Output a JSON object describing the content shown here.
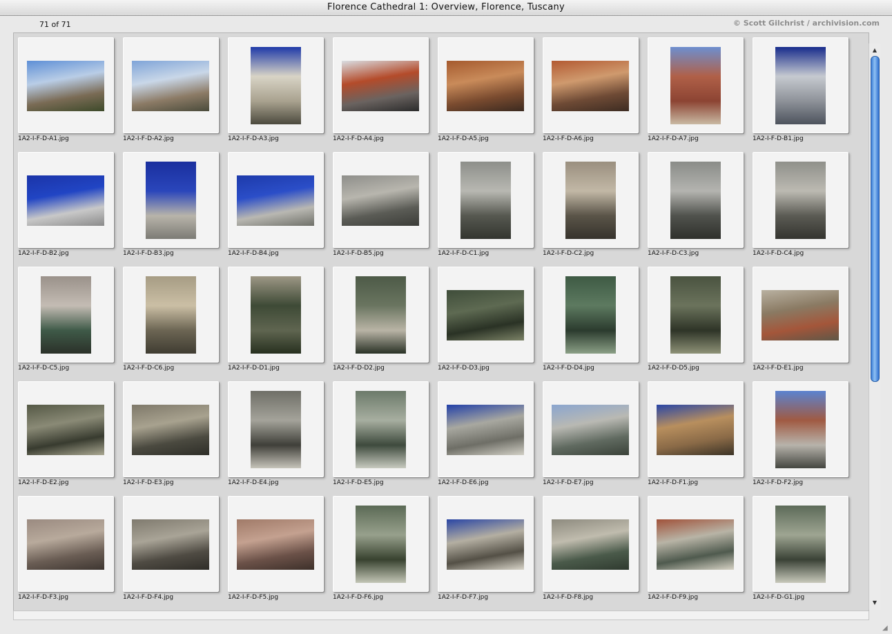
{
  "window": {
    "title": "Florence Cathedral 1: Overview, Florence, Tuscany"
  },
  "header": {
    "count": "71 of 71",
    "credit": "© Scott Gilchrist / archivision.com"
  },
  "thumbnails": [
    {
      "name": "1A2-I-F-D-A1.jpg",
      "orient": "land",
      "colors": [
        "#5e8fd6",
        "#b9cde6",
        "#7a6b55",
        "#3d4a2a"
      ]
    },
    {
      "name": "1A2-I-F-D-A2.jpg",
      "orient": "land",
      "colors": [
        "#7fa4d8",
        "#c9d7e8",
        "#8c7b66",
        "#4a4b3b"
      ]
    },
    {
      "name": "1A2-I-F-D-A3.jpg",
      "orient": "port",
      "colors": [
        "#1f3aa8",
        "#d8d4c6",
        "#a9a28f",
        "#4c4a3e"
      ]
    },
    {
      "name": "1A2-I-F-D-A4.jpg",
      "orient": "land",
      "colors": [
        "#d9dde2",
        "#b44b2a",
        "#6a6360",
        "#2b2b2b"
      ]
    },
    {
      "name": "1A2-I-F-D-A5.jpg",
      "orient": "land",
      "colors": [
        "#a55a2e",
        "#c98b5a",
        "#7a4b2f",
        "#3b2a20"
      ]
    },
    {
      "name": "1A2-I-F-D-A6.jpg",
      "orient": "land",
      "colors": [
        "#b35a32",
        "#cf9a6e",
        "#6e4a35",
        "#3d2c22"
      ]
    },
    {
      "name": "1A2-I-F-D-A7.jpg",
      "orient": "port",
      "colors": [
        "#6d8fcf",
        "#b06048",
        "#8c4433",
        "#c9b9a3"
      ]
    },
    {
      "name": "1A2-I-F-D-B1.jpg",
      "orient": "port",
      "colors": [
        "#182c8c",
        "#c6cad0",
        "#8e9299",
        "#4d535d"
      ]
    },
    {
      "name": "1A2-I-F-D-B2.jpg",
      "orient": "land",
      "colors": [
        "#1b34a8",
        "#2145c4",
        "#c8c8c8",
        "#8a8a8a"
      ]
    },
    {
      "name": "1A2-I-F-D-B3.jpg",
      "orient": "port",
      "colors": [
        "#1a2f9e",
        "#2a46bb",
        "#b8b4aa",
        "#7c7b75"
      ]
    },
    {
      "name": "1A2-I-F-D-B4.jpg",
      "orient": "land",
      "colors": [
        "#1d3aaa",
        "#2b4ec8",
        "#b9b8b2",
        "#6f7069"
      ]
    },
    {
      "name": "1A2-I-F-D-B5.jpg",
      "orient": "land",
      "colors": [
        "#8e8e8a",
        "#b8b6ae",
        "#5b5c56",
        "#3b3c38"
      ]
    },
    {
      "name": "1A2-I-F-D-C1.jpg",
      "orient": "port",
      "colors": [
        "#8d8f8a",
        "#b8b8b2",
        "#565850",
        "#33352f"
      ]
    },
    {
      "name": "1A2-I-F-D-C2.jpg",
      "orient": "port",
      "colors": [
        "#9a8f7f",
        "#c2b8a6",
        "#5a5448",
        "#36332c"
      ]
    },
    {
      "name": "1A2-I-F-D-C3.jpg",
      "orient": "port",
      "colors": [
        "#8a8c88",
        "#b4b4b0",
        "#50524d",
        "#2f302c"
      ]
    },
    {
      "name": "1A2-I-F-D-C4.jpg",
      "orient": "port",
      "colors": [
        "#8f908a",
        "#bcbab2",
        "#5b5b54",
        "#34342f"
      ]
    },
    {
      "name": "1A2-I-F-D-C5.jpg",
      "orient": "port",
      "colors": [
        "#9a918a",
        "#c4bcb4",
        "#3f5a48",
        "#2b3129"
      ]
    },
    {
      "name": "1A2-I-F-D-C6.jpg",
      "orient": "port",
      "colors": [
        "#a69c84",
        "#cbbfa5",
        "#6c6553",
        "#3f3c32"
      ]
    },
    {
      "name": "1A2-I-F-D-D1.jpg",
      "orient": "port",
      "colors": [
        "#9d9785",
        "#3e4a36",
        "#5f6550",
        "#27301f"
      ]
    },
    {
      "name": "1A2-I-F-D-D2.jpg",
      "orient": "port",
      "colors": [
        "#4d5a47",
        "#6a7560",
        "#b9b4a6",
        "#2a3226"
      ]
    },
    {
      "name": "1A2-I-F-D-D3.jpg",
      "orient": "land",
      "colors": [
        "#3f4d3a",
        "#5e6a52",
        "#2a3225",
        "#7b8266"
      ]
    },
    {
      "name": "1A2-I-F-D-D4.jpg",
      "orient": "port",
      "colors": [
        "#3e5a44",
        "#5d7a60",
        "#2b3b2e",
        "#8ba086"
      ]
    },
    {
      "name": "1A2-I-F-D-D5.jpg",
      "orient": "port",
      "colors": [
        "#4a5340",
        "#6b735c",
        "#2e3427",
        "#8e9277"
      ]
    },
    {
      "name": "1A2-I-F-D-E1.jpg",
      "orient": "land",
      "colors": [
        "#b9b1a1",
        "#8a7a63",
        "#a4563a",
        "#5e5747"
      ]
    },
    {
      "name": "1A2-I-F-D-E2.jpg",
      "orient": "land",
      "colors": [
        "#545845",
        "#8a8a76",
        "#383b2f",
        "#aaa892"
      ]
    },
    {
      "name": "1A2-I-F-D-E3.jpg",
      "orient": "land",
      "colors": [
        "#7e7869",
        "#a8a28f",
        "#4b4a40",
        "#2e2e28"
      ]
    },
    {
      "name": "1A2-I-F-D-E4.jpg",
      "orient": "port",
      "colors": [
        "#6f6f67",
        "#a4a39a",
        "#3f3f39",
        "#c6c4ba"
      ]
    },
    {
      "name": "1A2-I-F-D-E5.jpg",
      "orient": "port",
      "colors": [
        "#6c7a6a",
        "#a7aea0",
        "#3e4a3d",
        "#c7cabf"
      ]
    },
    {
      "name": "1A2-I-F-D-E6.jpg",
      "orient": "land",
      "colors": [
        "#2240a8",
        "#a8a8a0",
        "#6e6e66",
        "#d2d0c6"
      ]
    },
    {
      "name": "1A2-I-F-D-E7.jpg",
      "orient": "land",
      "colors": [
        "#8aa5cf",
        "#b9b9b3",
        "#606a60",
        "#3a4239"
      ]
    },
    {
      "name": "1A2-I-F-D-F1.jpg",
      "orient": "land",
      "colors": [
        "#2946a6",
        "#b88f5e",
        "#8a6a47",
        "#3b3326"
      ]
    },
    {
      "name": "1A2-I-F-D-F2.jpg",
      "orient": "port",
      "colors": [
        "#5b83d0",
        "#a05a42",
        "#b7b3ab",
        "#444640"
      ]
    },
    {
      "name": "1A2-I-F-D-F3.jpg",
      "orient": "land",
      "colors": [
        "#9a8a80",
        "#b8aa9c",
        "#6a5d54",
        "#3e3631"
      ]
    },
    {
      "name": "1A2-I-F-D-F4.jpg",
      "orient": "land",
      "colors": [
        "#7f7a6e",
        "#a9a497",
        "#4f4b43",
        "#2f2d28"
      ]
    },
    {
      "name": "1A2-I-F-D-F5.jpg",
      "orient": "land",
      "colors": [
        "#a07a68",
        "#c4a190",
        "#6b5148",
        "#3d302a"
      ]
    },
    {
      "name": "1A2-I-F-D-F6.jpg",
      "orient": "port",
      "colors": [
        "#5b6a55",
        "#97a08c",
        "#38422f",
        "#c3c6b6"
      ]
    },
    {
      "name": "1A2-I-F-D-F7.jpg",
      "orient": "land",
      "colors": [
        "#2a46a4",
        "#b4afa2",
        "#545046",
        "#d8d4c8"
      ]
    },
    {
      "name": "1A2-I-F-D-F8.jpg",
      "orient": "land",
      "colors": [
        "#8d8a7e",
        "#c0bcae",
        "#4a5a4a",
        "#2f3a2f"
      ]
    },
    {
      "name": "1A2-I-F-D-F9.jpg",
      "orient": "land",
      "colors": [
        "#a0523a",
        "#b8b4a6",
        "#4f5a4e",
        "#d6d2c4"
      ]
    },
    {
      "name": "1A2-I-F-D-G1.jpg",
      "orient": "port",
      "colors": [
        "#5c6a58",
        "#9ea592",
        "#3a4236",
        "#c8c9bb"
      ]
    }
  ]
}
